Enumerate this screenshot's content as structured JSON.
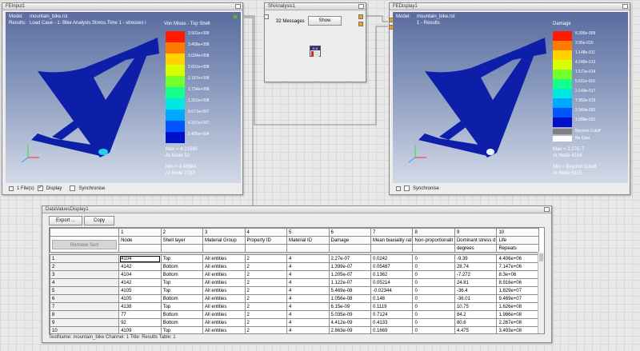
{
  "fe_input": {
    "title": "FEInput1",
    "model_label": "Model:",
    "model_value": "mountain_bike.rst",
    "results_label": "Results:",
    "results_value": "Load Case - 1: Bike Analysis.Stress.Time 1 - stresses i",
    "legend_title": "Von Mises - Top Shell",
    "legend_values": [
      "3.901e+008",
      "3.468e+008",
      "3.034e+008",
      "2.601e+008",
      "2.167e+008",
      "1.734e+008",
      "1.301e+008",
      "8.671e+007",
      "4.337e+007",
      "2.405e+004"
    ],
    "legend_colors": [
      "#ff1a00",
      "#ff7a00",
      "#ffd200",
      "#d8ff00",
      "#74ff2a",
      "#15ff8a",
      "#00e8e0",
      "#00a8ff",
      "#0055ff",
      "#0010c8"
    ],
    "max_line1": "Max = 4.31585",
    "max_line2": "At Node 52",
    "min_line1": "Min = 2.40884",
    "min_line2": "At Node 2782",
    "files_label": "1 File(s)",
    "display_label": "Display",
    "synchronise_label": "Synchronise"
  },
  "sn_analysis": {
    "title": "SNAnalysis1",
    "messages": "32 Messages",
    "show_label": "Show",
    "icon_label": "S-N"
  },
  "fe_display": {
    "title": "FEDisplay1",
    "model_label": "Model:",
    "model_value": "mountain_bike.rst",
    "results_value": "1 - Results",
    "legend_title": "Damage",
    "legend_values": [
      "8.395e-009",
      "3.95e-010",
      "1.148e-011",
      "4.248e-013",
      "1.571e-014",
      "5.811e-016",
      "2.149e-017",
      "7.950e-019",
      "2.940e-020",
      "1.088e-021"
    ],
    "legend_colors": [
      "#ff1a00",
      "#ff7a00",
      "#ffd200",
      "#d8ff00",
      "#74ff2a",
      "#15ff8a",
      "#00e8e0",
      "#00a8ff",
      "#0055ff",
      "#0010c8"
    ],
    "beyond_label": "Beyond Cutoff",
    "nodata_label": "No Data",
    "max_line1": "Max = 2.27E-7",
    "max_line2": "At Node 4104",
    "min_line1": "Min = Beyond Cutoff",
    "min_line2": "At Node 6115",
    "synchronise_label": "Synchronise"
  },
  "data_display": {
    "title": "DataValuesDisplay1",
    "export_label": "Export ...",
    "copy_label": "Copy",
    "remove_sort_label": "Remove Sort",
    "col_numbers": [
      "1",
      "2",
      "3",
      "4",
      "5",
      "6",
      "7",
      "8",
      "9",
      "10"
    ],
    "col_headers": [
      "Node",
      "Shell layer",
      "Material Group",
      "Property ID",
      "Material ID",
      "Damage",
      "Mean biaxiality rat",
      "Non-proportionalit",
      "Dominant stress d",
      "Life"
    ],
    "units_row": [
      "",
      "",
      "",
      "",
      "",
      "",
      "",
      "",
      "degrees",
      "Repeats"
    ],
    "rows": [
      [
        "1",
        "4104",
        "Top",
        "All entities",
        "2",
        "4",
        "2.27e-07",
        "0.0242",
        "0",
        "-9.39",
        "4.406e+06"
      ],
      [
        "2",
        "4142",
        "Bottom",
        "All entities",
        "2",
        "4",
        "1.399e-07",
        "0.05487",
        "0",
        "28.74",
        "7.147e+06"
      ],
      [
        "3",
        "4104",
        "Bottom",
        "All entities",
        "2",
        "4",
        "1.205e-07",
        "0.1362",
        "0",
        "-7.272",
        "8.3e+06"
      ],
      [
        "4",
        "4142",
        "Top",
        "All entities",
        "2",
        "4",
        "1.122e-07",
        "0.05214",
        "0",
        "24.81",
        "8.916e+06"
      ],
      [
        "5",
        "4105",
        "Top",
        "All entities",
        "2",
        "4",
        "5.469e-08",
        "-0.02344",
        "0",
        "-36.4",
        "1.829e+07"
      ],
      [
        "6",
        "4105",
        "Bottom",
        "All entities",
        "2",
        "4",
        "1.056e-08",
        "0.148",
        "0",
        "-36.01",
        "9.469e+07"
      ],
      [
        "7",
        "4138",
        "Top",
        "All entities",
        "2",
        "4",
        "6.15e-09",
        "0.1119",
        "0",
        "10.75",
        "1.626e+08"
      ],
      [
        "8",
        "77",
        "Bottom",
        "All entities",
        "2",
        "4",
        "5.035e-09",
        "0.7124",
        "0",
        "84.2",
        "1.986e+08"
      ],
      [
        "9",
        "92",
        "Bottom",
        "All entities",
        "2",
        "4",
        "4.412e-09",
        "0.4133",
        "0",
        "80.6",
        "2.267e+08"
      ],
      [
        "10",
        "4109",
        "Top",
        "All entities",
        "2",
        "4",
        "2.863e-09",
        "0.1669",
        "0",
        "4.475",
        "3.493e+08"
      ]
    ],
    "status": "TestName: mountain_bike  Channel: 1  Title: Results  Table: 1"
  }
}
